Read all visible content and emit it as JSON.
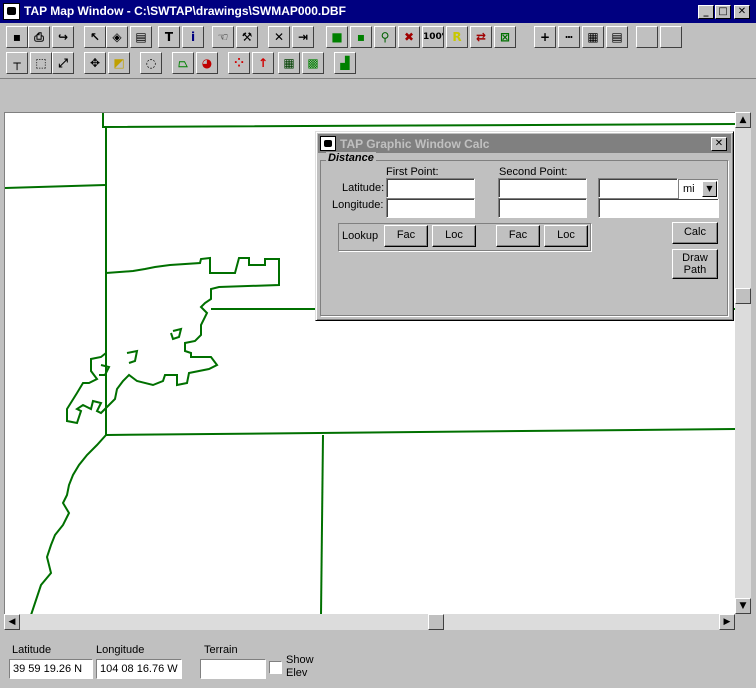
{
  "window": {
    "title": "TAP Map Window - C:\\SWTAP\\drawings\\SWMAP000.DBF",
    "controls": {
      "minimize": "_",
      "maximize": "□",
      "close": "✕"
    }
  },
  "toolbar1": [
    {
      "icon": "save-icon",
      "glyph": "▪"
    },
    {
      "icon": "print-icon",
      "glyph": "⎙"
    },
    {
      "icon": "redo-arrow-icon",
      "glyph": "↪"
    },
    {
      "icon": "pointer-icon",
      "glyph": "↖"
    },
    {
      "icon": "paint-bucket-icon",
      "glyph": "◈"
    },
    {
      "icon": "layers-icon",
      "glyph": "▤"
    },
    {
      "icon": "text-icon",
      "glyph": "T"
    },
    {
      "icon": "info-icon",
      "glyph": "i"
    },
    {
      "icon": "hand-pan-icon",
      "glyph": "☜"
    },
    {
      "icon": "wrench-icon",
      "glyph": "⚒"
    },
    {
      "icon": "delete-x-icon",
      "glyph": "✕"
    },
    {
      "icon": "exit-door-icon",
      "glyph": "⇥"
    },
    {
      "icon": "green-square-icon",
      "glyph": "■"
    },
    {
      "icon": "small-square-icon",
      "glyph": "▪"
    },
    {
      "icon": "pin-icon",
      "glyph": "⚲"
    },
    {
      "icon": "red-x-square-icon",
      "glyph": "✖"
    },
    {
      "icon": "zoom-100-icon",
      "glyph": "100%"
    },
    {
      "icon": "r-icon",
      "glyph": "R"
    },
    {
      "icon": "transfer-icon",
      "glyph": "⇄"
    },
    {
      "icon": "crossed-square-icon",
      "glyph": "⊠"
    },
    {
      "icon": "plus-icon",
      "glyph": "+"
    },
    {
      "icon": "ruler-icon",
      "glyph": "┅"
    },
    {
      "icon": "grid-icon",
      "glyph": "▦"
    },
    {
      "icon": "document-icon",
      "glyph": "▤"
    },
    {
      "icon": "blank-icon",
      "glyph": ""
    },
    {
      "icon": "blank-icon",
      "glyph": ""
    }
  ],
  "toolbar2": [
    {
      "icon": "line-tool-icon",
      "glyph": "┬"
    },
    {
      "icon": "select-box-icon",
      "glyph": "⬚"
    },
    {
      "icon": "resize-diagonal-icon",
      "glyph": "⤢"
    },
    {
      "icon": "move-crosshair-icon",
      "glyph": "✥"
    },
    {
      "icon": "overlay-squares-icon",
      "glyph": "◩"
    },
    {
      "icon": "lasso-icon",
      "glyph": "◌"
    },
    {
      "icon": "area-polygon-icon",
      "glyph": "⏢"
    },
    {
      "icon": "pie-chart-icon",
      "glyph": "◕"
    },
    {
      "icon": "scatter-points-icon",
      "glyph": "⁘"
    },
    {
      "icon": "tower-arrow-icon",
      "glyph": "↑"
    },
    {
      "icon": "color-grid-icon",
      "glyph": "▦"
    },
    {
      "icon": "multicolor-grid-icon",
      "glyph": "▩"
    },
    {
      "icon": "profile-chart-icon",
      "glyph": "▟"
    }
  ],
  "calc": {
    "title": "TAP Graphic Window Calc",
    "group_label": "Distance",
    "first_point_label": "First Point:",
    "second_point_label": "Second Point:",
    "latitude_label": "Latitude:",
    "longitude_label": "Longitude:",
    "first_lat": "",
    "first_lon": "",
    "second_lat": "",
    "second_lon": "",
    "result": "",
    "result2": "",
    "unit": "mi",
    "lookup_label": "Lookup",
    "fac1": "Fac",
    "loc1": "Loc",
    "fac2": "Fac",
    "loc2": "Loc",
    "calc_button": "Calc",
    "draw_path_line1": "Draw",
    "draw_path_line2": "Path",
    "close": "✕"
  },
  "status": {
    "latitude_label": "Latitude",
    "latitude_value": "39 59 19.26 N",
    "longitude_label": "Longitude",
    "longitude_value": "104 08 16.76 W",
    "terrain_label": "Terrain",
    "terrain_value": "",
    "show_elev_line1": "Show",
    "show_elev_line2": "Elev"
  },
  "colors": {
    "title_active": "#000080",
    "title_inactive": "#808080",
    "map_line": "#007000"
  }
}
